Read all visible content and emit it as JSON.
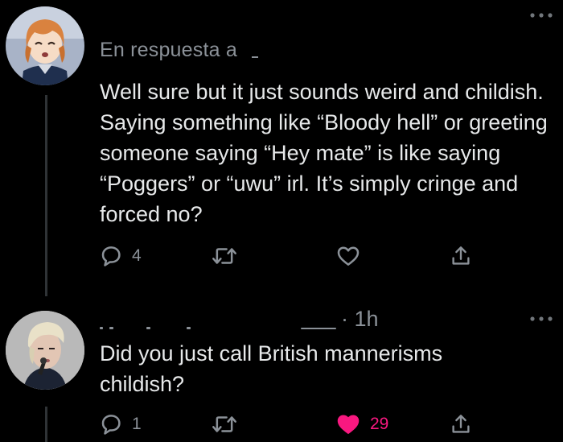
{
  "tweets": [
    {
      "reply_context": "En respuesta a",
      "text": "Well sure but it just sounds weird and childish. Saying something like “Bloody hell” or greeting someone saying “Hey mate” is like saying “Poggers” or “uwu” irl. It’s simply cringe and forced no?",
      "actions": {
        "reply_count": "4",
        "retweet_count": "",
        "like_count": "",
        "liked": false
      },
      "avatar_icon": "anime-girl-avatar-icon"
    },
    {
      "time": "· 1h",
      "text": "Did you just call British mannerisms childish?",
      "actions": {
        "reply_count": "1",
        "retweet_count": "",
        "like_count": "29",
        "liked": true
      },
      "avatar_icon": "singer-avatar-icon"
    }
  ],
  "icons": {
    "more": "more-dots-icon",
    "reply": "reply-bubble-icon",
    "retweet": "retweet-icon",
    "like": "heart-icon",
    "share": "share-icon"
  },
  "colors": {
    "background": "#000000",
    "text": "#e7e9ea",
    "secondary": "#8b9198",
    "like": "#f91880",
    "thread_line": "#2f3336"
  }
}
